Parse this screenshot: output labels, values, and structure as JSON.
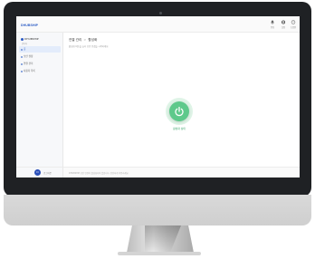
{
  "app": {
    "brand": "DHUBSHIP"
  },
  "toolbar": {
    "items": [
      {
        "label": "알림",
        "icon": "bell-icon"
      },
      {
        "label": "설정",
        "icon": "gear-icon"
      },
      {
        "label": "도움말",
        "icon": "help-icon"
      }
    ]
  },
  "sidebar": {
    "profile_name": "DHUBSHIP",
    "profile_sub": "관리자",
    "items": [
      {
        "label": "홈",
        "active": true
      },
      {
        "label": "보안 설정",
        "active": false
      },
      {
        "label": "연결 관리",
        "active": false
      },
      {
        "label": "사용자 목록",
        "active": false
      }
    ],
    "footer_initial": "D",
    "footer_label": "로그아웃"
  },
  "main": {
    "breadcrumb": [
      "연결 관리",
      "활성화"
    ],
    "description": "활성화 버튼을 눌러 보안 연결을 시작하세요.",
    "power_label": "활성화 상태"
  },
  "statusbar": {
    "text": "DHUBSHIP 보안 연결이 활성화되어 있습니다. 안전하게 이용하세요."
  },
  "colors": {
    "accent": "#2c5cc5",
    "power_green": "#5ec98b",
    "bezel": "#1f2124"
  }
}
